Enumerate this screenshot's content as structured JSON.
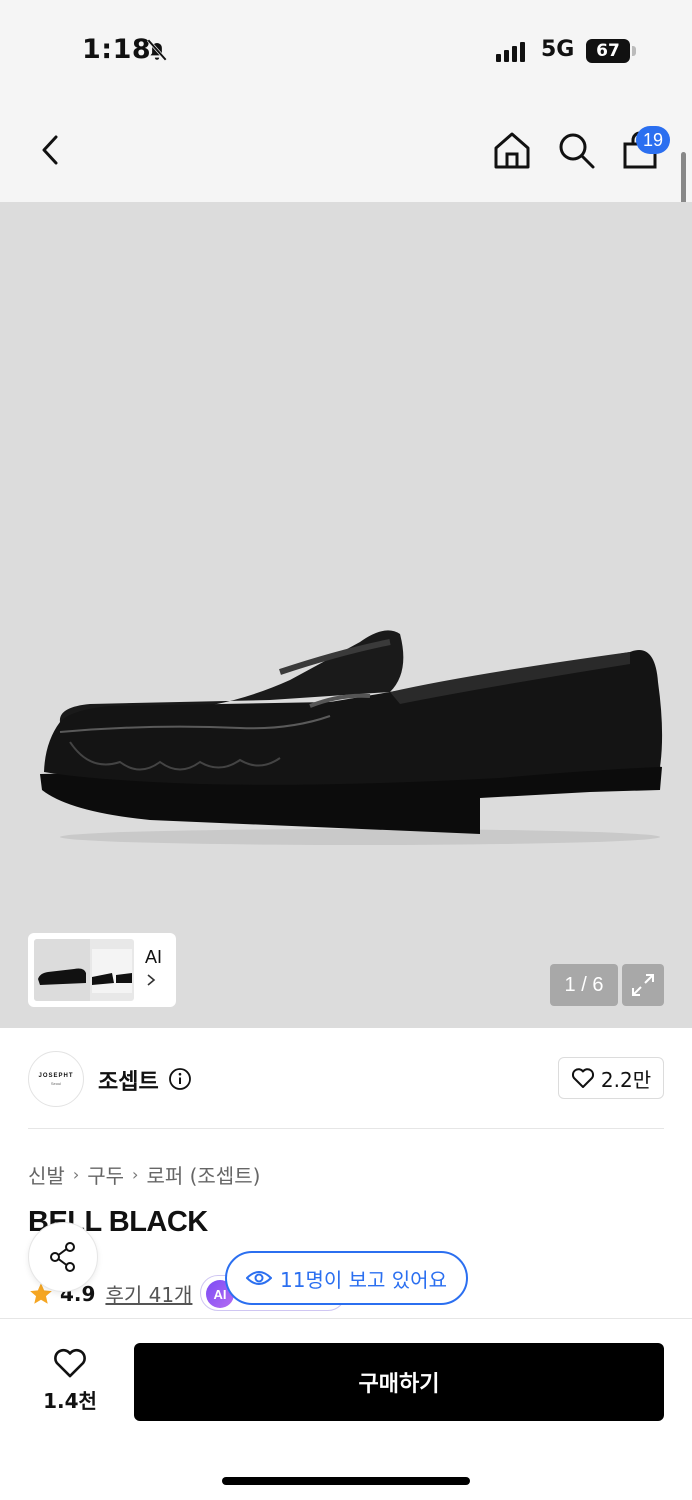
{
  "status_bar": {
    "time": "1:18",
    "network": "5G",
    "battery": "67"
  },
  "nav": {
    "cart_count": "19",
    "icons": [
      "back-icon",
      "home-icon",
      "search-icon",
      "bag-icon"
    ]
  },
  "gallery": {
    "ai_label": "AI",
    "page_indicator": "1 / 6"
  },
  "brand": {
    "logo_text": "JOSEPHT",
    "logo_sub": "Seoul",
    "name": "조셉트",
    "like_count": "2.2만"
  },
  "breadcrumb": [
    "신발",
    "구두",
    "로퍼 (조셉트)"
  ],
  "product": {
    "name": "BELL BLACK",
    "rating": "4.9",
    "reviews": "후기 41개",
    "ai_badge": "AI"
  },
  "viewers_text": "11명이 보고 있어요",
  "bottom_bar": {
    "like_count": "1.4천",
    "buy_label": "구매하기"
  },
  "colors": {
    "accent": "#2b6ff0",
    "buy_button": "#000000",
    "star": "#f5a623",
    "image_bg": "#dcdcdc"
  }
}
